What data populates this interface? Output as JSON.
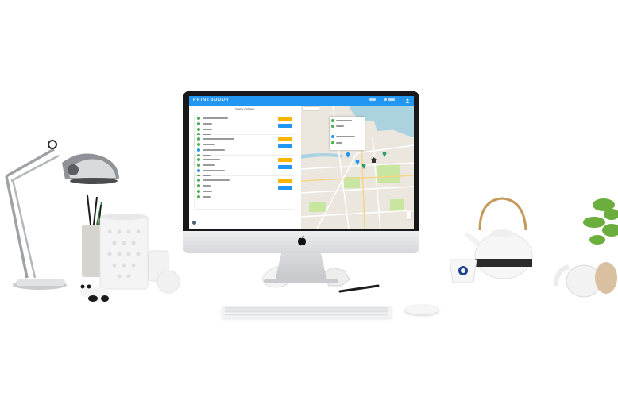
{
  "app": {
    "brand": "PRINTBUDDY",
    "list_title": "Nearby of Mission"
  },
  "icons": {
    "apple_logo": "apple-icon",
    "user": "user-icon",
    "pin": "map-pin-icon"
  },
  "colors": {
    "header_blue": "#2196f3",
    "button_yellow": "#f7b500",
    "button_blue": "#2196f3",
    "status_green": "#4caf50",
    "map_water": "#aad3df",
    "map_park": "#c8e6a0"
  }
}
